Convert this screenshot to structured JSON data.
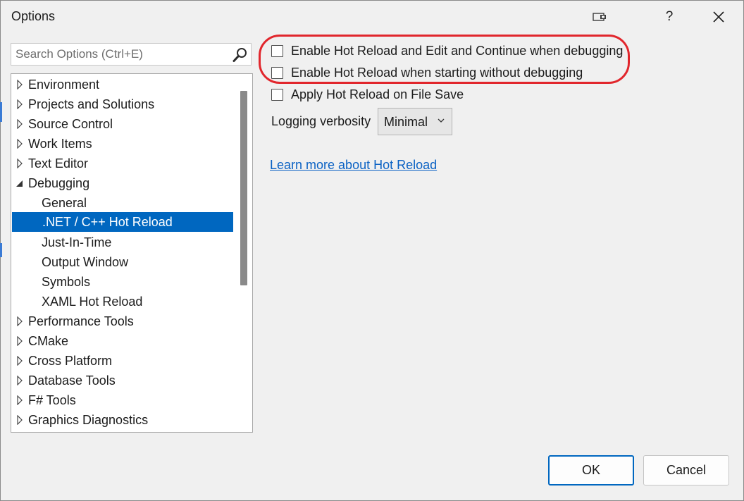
{
  "window": {
    "title": "Options",
    "help_label": "?"
  },
  "search": {
    "placeholder": "Search Options (Ctrl+E)"
  },
  "tree": {
    "items": [
      {
        "label": "Environment",
        "expanded": false
      },
      {
        "label": "Projects and Solutions",
        "expanded": false
      },
      {
        "label": "Source Control",
        "expanded": false
      },
      {
        "label": "Work Items",
        "expanded": false
      },
      {
        "label": "Text Editor",
        "expanded": false
      },
      {
        "label": "Debugging",
        "expanded": true
      },
      {
        "label": "General"
      },
      {
        "label": ".NET / C++ Hot Reload",
        "selected": true
      },
      {
        "label": "Just-In-Time"
      },
      {
        "label": "Output Window"
      },
      {
        "label": "Symbols"
      },
      {
        "label": "XAML Hot Reload"
      },
      {
        "label": "Performance Tools",
        "expanded": false
      },
      {
        "label": "CMake",
        "expanded": false
      },
      {
        "label": "Cross Platform",
        "expanded": false
      },
      {
        "label": "Database Tools",
        "expanded": false
      },
      {
        "label": "F# Tools",
        "expanded": false
      },
      {
        "label": "Graphics Diagnostics",
        "expanded": false
      }
    ]
  },
  "options": {
    "checkboxes": [
      {
        "label": "Enable Hot Reload and Edit and Continue when debugging",
        "checked": false
      },
      {
        "label": "Enable Hot Reload when starting without debugging",
        "checked": false
      },
      {
        "label": "Apply Hot Reload on File Save",
        "checked": false
      }
    ],
    "logging_label": "Logging verbosity",
    "logging_value": "Minimal",
    "learn_more": "Learn more about Hot Reload"
  },
  "buttons": {
    "ok": "OK",
    "cancel": "Cancel"
  },
  "colors": {
    "selection": "#0067c0",
    "highlight_outline": "#e1262c",
    "link": "#0b62c4"
  }
}
